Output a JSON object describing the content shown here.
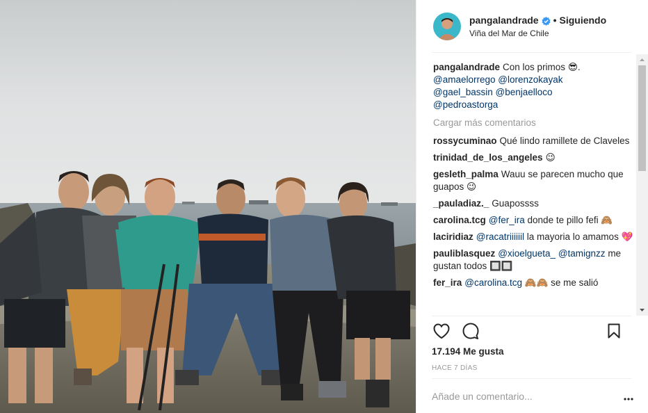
{
  "post": {
    "photo_alt": "",
    "header": {
      "username": "pangalandrade",
      "verified_icon": "verified-badge-icon",
      "separator": "•",
      "follow_status": "Siguiendo",
      "location": "Viña del Mar de Chile"
    },
    "caption": {
      "username": "pangalandrade",
      "text": "Con los primos 😎.",
      "mentions": [
        "@amaelorrego",
        "@lorenzokayak",
        "@gael_bassin",
        "@benjaelloco",
        "@pedroastorga"
      ]
    },
    "load_more": "Cargar más comentarios",
    "comments": [
      {
        "user": "rossycuminao",
        "text": "Qué lindo ramillete de Claveles"
      },
      {
        "user": "trinidad_de_los_angeles",
        "text": "😉"
      },
      {
        "user": "gesleth_palma",
        "text": "Wauu se parecen mucho que guapos 😉"
      },
      {
        "user": "_pauladiaz._",
        "text": "Guapossss"
      },
      {
        "user": "carolina.tcg",
        "mention": "@fer_ira",
        "text": "donde te pillo fefi 🙈"
      },
      {
        "user": "laciridiaz",
        "mention": "@racatriiiiiil",
        "text": "la mayoria lo amamos 💖"
      },
      {
        "user": "pauliblasquez",
        "mention": "@xioelgueta_",
        "mention2": "@tamignzz",
        "text": "me gustan todos 🔲🔲"
      },
      {
        "user": "fer_ira",
        "mention": "@carolina.tcg",
        "text": "🙈🙈 se me salió"
      }
    ],
    "actions": {
      "like_icon": "heart-icon",
      "comment_icon": "comment-bubble-icon",
      "save_icon": "bookmark-icon"
    },
    "likes": "17.194 Me gusta",
    "time": "HACE 7 DÍAS",
    "add_comment": {
      "placeholder": "Añade un comentario...",
      "more_icon": "more-options-icon"
    },
    "colors": {
      "text": "#262626",
      "mention": "#003569",
      "muted": "#999999",
      "verified": "#3897f0"
    }
  }
}
